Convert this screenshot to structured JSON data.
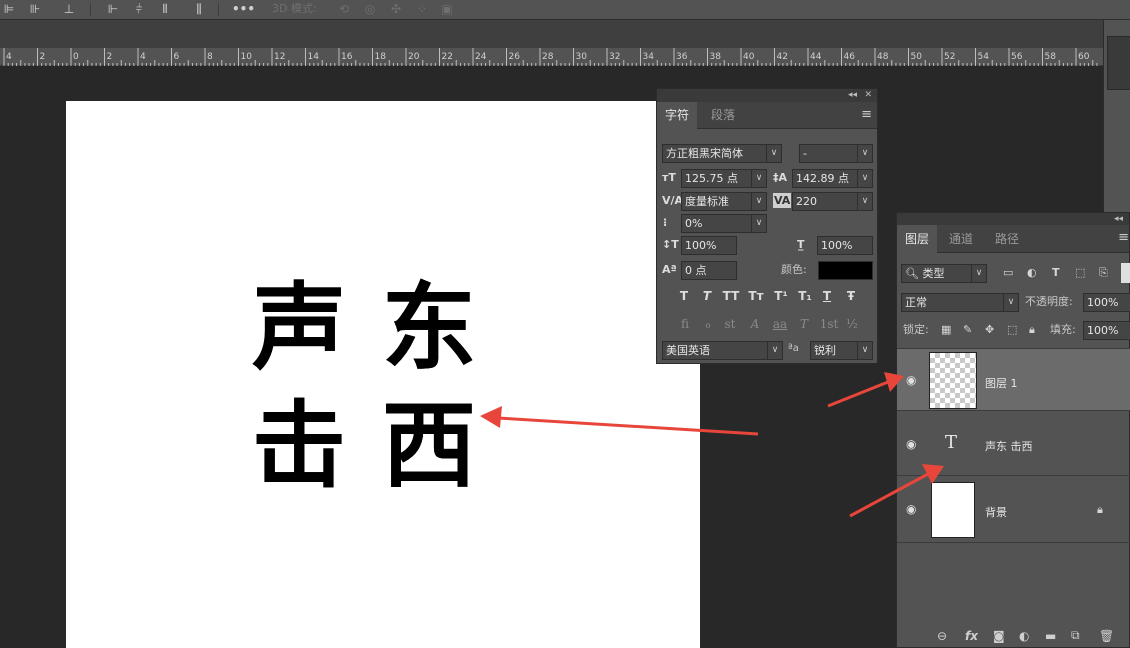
{
  "options_bar": {
    "mode_3d_label": "3D 模式:",
    "more_icon": "ellipsis-icon"
  },
  "ruler": {
    "labels": [
      "4",
      "2",
      "0",
      "2",
      "4",
      "6",
      "8",
      "10",
      "12",
      "14",
      "16",
      "18",
      "20",
      "22",
      "24",
      "26",
      "28",
      "30",
      "32",
      "34",
      "36",
      "38",
      "40",
      "42",
      "44",
      "46",
      "48",
      "50",
      "52",
      "54",
      "56",
      "58",
      "60"
    ]
  },
  "canvas": {
    "chars": [
      "声",
      "东",
      "击",
      "西"
    ]
  },
  "character_panel": {
    "collapse_icon": "double-chevron-icon",
    "close_icon": "close-icon",
    "tabs": [
      "字符",
      "段落"
    ],
    "font_family": "方正粗黑宋简体",
    "font_style": "-",
    "font_size": "125.75 点",
    "leading": "142.89 点",
    "kerning": "度量标准",
    "tracking": "220",
    "tsume": "0%",
    "vertical_scale": "100%",
    "horizontal_scale": "100%",
    "baseline_shift": "0 点",
    "color_label": "颜色:",
    "color": "#000000",
    "style_buttons": [
      "T",
      "T",
      "TT",
      "Tт",
      "T¹",
      "T₁",
      "T",
      "Ŧ"
    ],
    "opentype_buttons": [
      "fi",
      "ℴ",
      "st",
      "A",
      "aa",
      "T",
      "1st",
      "½"
    ],
    "language": "美国英语",
    "aa_label": "ªa",
    "antialias": "锐利"
  },
  "layers_panel": {
    "tabs": [
      "图层",
      "通道",
      "路径"
    ],
    "filter_kind": "类型",
    "blend_mode": "正常",
    "opacity_label": "不透明度:",
    "opacity": "100%",
    "lock_label": "锁定:",
    "fill_label": "填充:",
    "fill": "100%",
    "layers": [
      {
        "name": "图层 1",
        "type": "pixel",
        "selected": true
      },
      {
        "name": "声东 击西",
        "type": "text",
        "selected": false
      },
      {
        "name": "背景",
        "type": "background",
        "selected": false
      }
    ]
  },
  "colors": {
    "panel": "#535353",
    "workspace": "#282828",
    "arrow": "#e8463a"
  }
}
